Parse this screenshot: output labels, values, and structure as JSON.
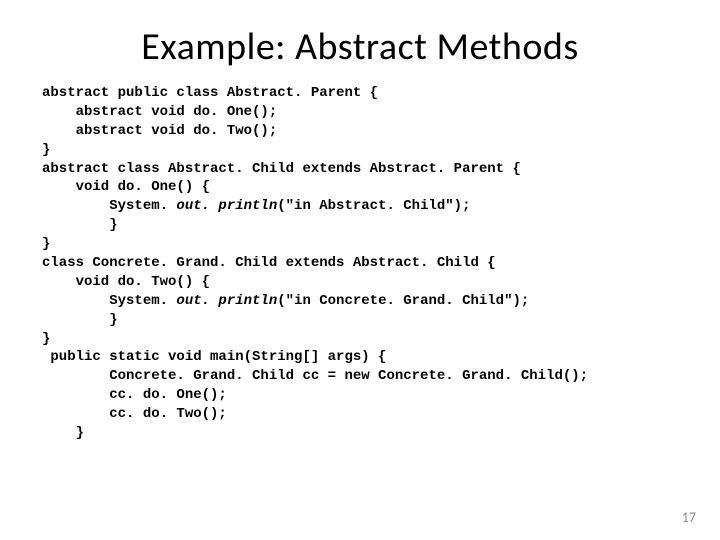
{
  "title": "Example: Abstract Methods",
  "code": {
    "l1": "abstract public class Abstract. Parent {",
    "l2": "    abstract void do. One();",
    "l3": "    abstract void do. Two();",
    "l4": "}",
    "l5": "abstract class Abstract. Child extends Abstract. Parent {",
    "l6": "    void do. One() {",
    "l7a": "        System. ",
    "l7b": "out. println",
    "l7c": "(\"in Abstract. Child\");",
    "l8": "        }",
    "l9": "}",
    "l10": "class Concrete. Grand. Child extends Abstract. Child {",
    "l11": "    void do. Two() {",
    "l12a": "        System. ",
    "l12b": "out. println",
    "l12c": "(\"in Concrete. Grand. Child\");",
    "l13": "        }",
    "l14": "}",
    "l15": " public static void main(String[] args) {",
    "l16": "        Concrete. Grand. Child cc = new Concrete. Grand. Child();",
    "l17": "        cc. do. One();",
    "l18": "        cc. do. Two();",
    "l19": "    }"
  },
  "pagenum": "17"
}
